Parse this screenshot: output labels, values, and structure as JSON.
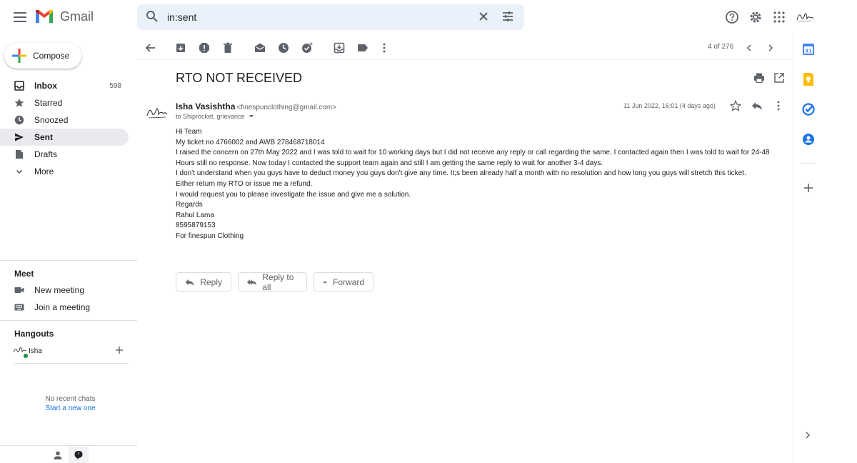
{
  "app": {
    "name": "Gmail"
  },
  "search": {
    "value": "in:sent"
  },
  "compose": {
    "label": "Compose"
  },
  "sidebar": {
    "items": [
      {
        "label": "Inbox",
        "count": "598"
      },
      {
        "label": "Starred",
        "count": ""
      },
      {
        "label": "Snoozed",
        "count": ""
      },
      {
        "label": "Sent",
        "count": ""
      },
      {
        "label": "Drafts",
        "count": ""
      },
      {
        "label": "More",
        "count": ""
      }
    ],
    "meet": {
      "title": "Meet",
      "new_meeting": "New meeting",
      "join_meeting": "Join a meeting"
    },
    "hangouts": {
      "title": "Hangouts",
      "user": "Isha",
      "no_recent": "No recent chats",
      "start_new": "Start a new one"
    }
  },
  "toolbar": {
    "pager": "4 of 276"
  },
  "email": {
    "subject": "RTO NOT RECEIVED",
    "sender_name": "Isha Vasishtha",
    "sender_email": "<finespunclothing@gmail.com>",
    "to": "to Shiprocket, grievance",
    "date": "11 Jun 2022, 16:01 (4 days ago)",
    "body": [
      "Hi Team",
      "My ticket no 4766002 and AWB 278468718014",
      "I raised the concern on 27th May 2022 and I was told to wait for 10 working days but I did not receive any reply or call regarding the same. I contacted again then I was told to wait for 24-48 Hours still no response. Now today I contacted the support team again and still I am getting the same reply to wait for another 3-4 days.",
      "I don't understand when you guys have to deduct money you guys don't give any time. It;s been already half a month with no resolution and how long you guys will stretch this ticket.",
      "Either return my RTO or issue me a refund.",
      "I would request you to please investigate the issue and give me a solution.",
      "Regards",
      "Rahul Lama",
      "8595879153",
      "For finespun Clothing"
    ],
    "actions": {
      "reply": "Reply",
      "reply_all": "Reply to all",
      "forward": "Forward"
    }
  },
  "colors": {
    "accent_blue": "#1a73e8",
    "active_bg": "#e8eaed",
    "search_bg": "#eaf1fb",
    "online_green": "#1e8e3e"
  }
}
